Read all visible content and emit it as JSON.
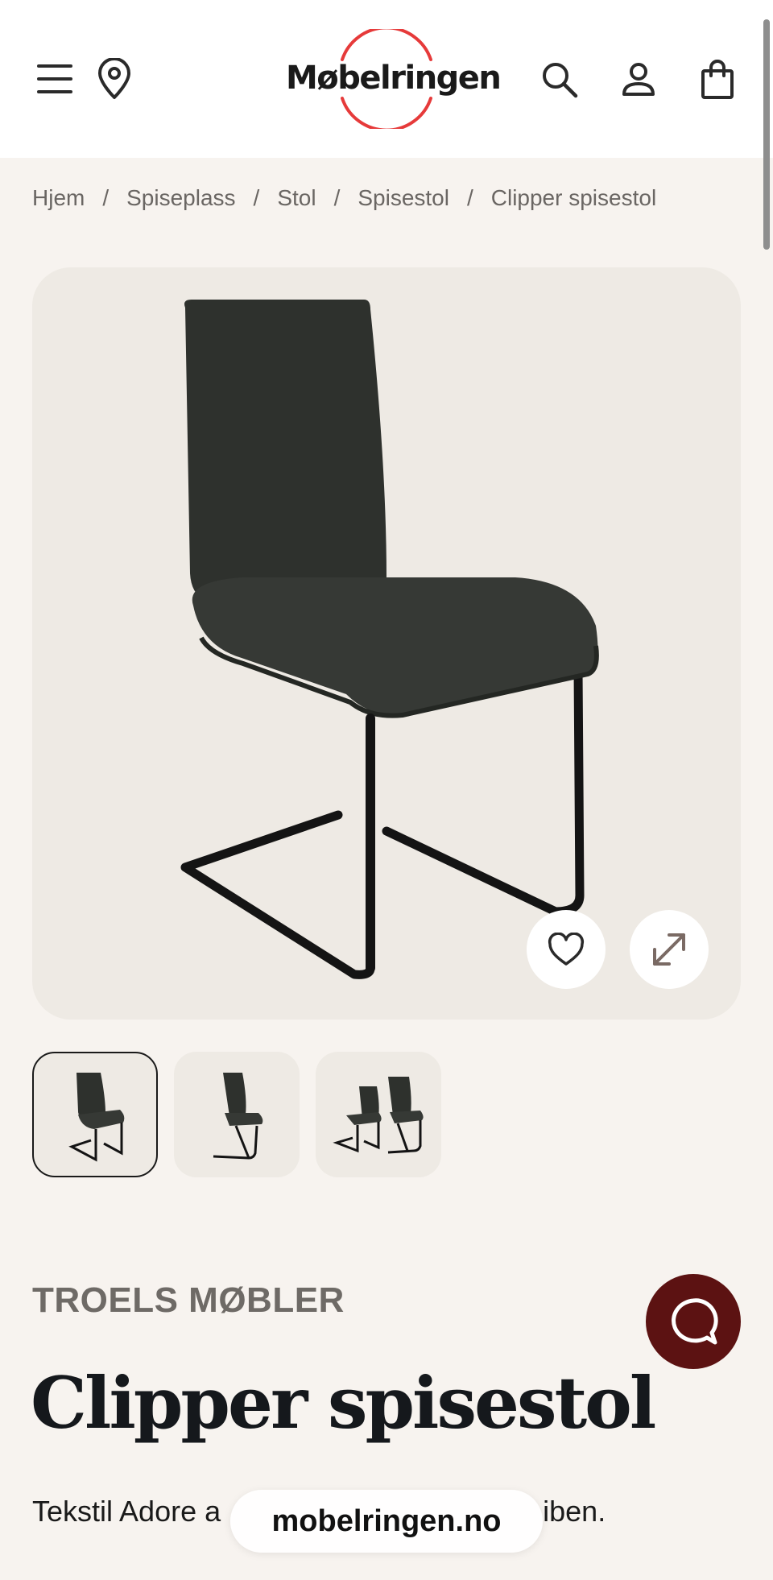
{
  "header": {
    "logo_text": "Møbelringen",
    "menu_icon": "hamburger-menu-icon",
    "location_icon": "map-pin-icon",
    "search_icon": "search-icon",
    "account_icon": "user-icon",
    "cart_icon": "shopping-bag-icon",
    "brand_color": "#e63a3a"
  },
  "breadcrumb": {
    "items": [
      "Hjem",
      "Spiseplass",
      "Stol",
      "Spisestol",
      "Clipper spisestol"
    ],
    "separator": "/"
  },
  "gallery": {
    "favorite_icon": "heart-icon",
    "expand_icon": "expand-arrows-icon",
    "thumbnails": [
      {
        "view": "single-chair-front",
        "active": true
      },
      {
        "view": "single-chair-side",
        "active": false
      },
      {
        "view": "two-chairs",
        "active": false
      }
    ]
  },
  "product": {
    "brand": "TROELS MØBLER",
    "title": "Clipper spisestol",
    "description": "Tekstil Adore a",
    "description_end": "iben."
  },
  "chat": {
    "icon": "chat-bubble-icon",
    "color": "#5c1212"
  },
  "browser": {
    "url": "mobelringen.no"
  }
}
